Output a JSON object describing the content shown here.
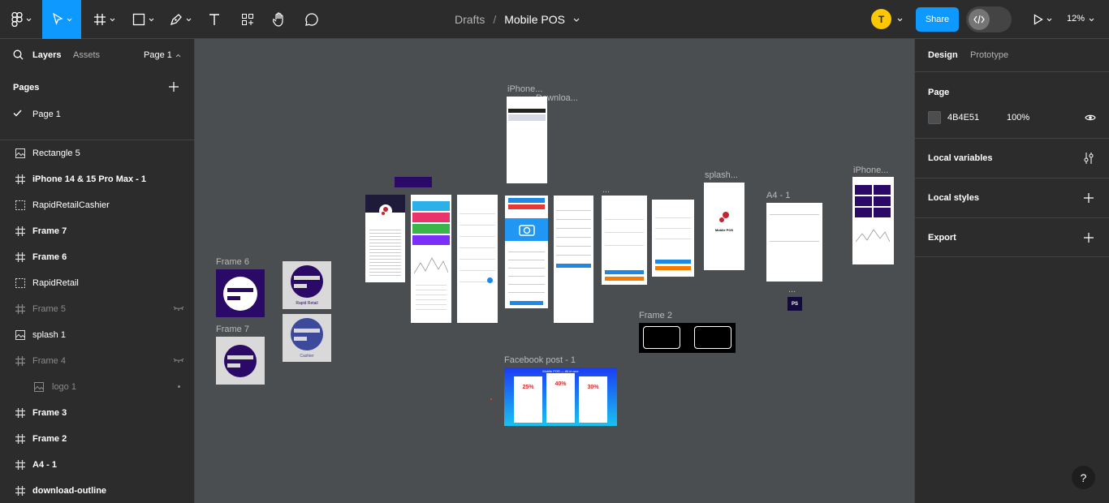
{
  "toolbar": {
    "breadcrumb_root": "Drafts",
    "breadcrumb_sep": "/",
    "file_name": "Mobile POS",
    "avatar_initial": "T",
    "share_label": "Share",
    "zoom": "12%",
    "accent_color": "#0d99ff"
  },
  "left_panel": {
    "tabs": {
      "layers": "Layers",
      "assets": "Assets",
      "page_switch": "Page 1"
    },
    "pages_title": "Pages",
    "current_page": "Page 1",
    "layers": [
      {
        "label": "Rectangle 5",
        "icon": "image-icon"
      },
      {
        "label": "iPhone 14 & 15 Pro Max - 1",
        "icon": "frame-icon"
      },
      {
        "label": "RapidRetailCashier",
        "icon": "section-icon"
      },
      {
        "label": "Frame 7",
        "icon": "frame-icon"
      },
      {
        "label": "Frame 6",
        "icon": "frame-icon"
      },
      {
        "label": "RapidRetail",
        "icon": "section-icon"
      },
      {
        "label": "Frame 5",
        "icon": "frame-icon"
      },
      {
        "label": "splash 1",
        "icon": "image-icon"
      },
      {
        "label": "Frame 4",
        "icon": "frame-icon"
      },
      {
        "label": "logo 1",
        "icon": "image-icon"
      },
      {
        "label": "Frame 3",
        "icon": "frame-icon"
      },
      {
        "label": "Frame 2",
        "icon": "frame-icon"
      },
      {
        "label": "A4 - 1",
        "icon": "frame-icon"
      },
      {
        "label": "download-outline",
        "icon": "frame-icon"
      }
    ]
  },
  "canvas": {
    "background": "#4b4e51",
    "labels": {
      "frame6": "Frame 6",
      "frame7": "Frame 7",
      "iphone_top": "iPhone...",
      "download": "Downloa...",
      "splash": "splash...",
      "a4": "A4 - 1",
      "iphone_right": "iPhone...",
      "frame2": "Frame 2",
      "facebook": "Facebook post - 1",
      "logo_rapid": "Rapid Retail",
      "logo_cashier": "Cashier",
      "splash_app": "Mobile POS",
      "ellipsis": "...",
      "fb_header": "Mobile POS — All-in-one",
      "fb_offer1": "25%",
      "fb_offer2": "40%",
      "fb_offer3": "30%",
      "ps_badge": "PS"
    }
  },
  "right_panel": {
    "tabs": {
      "design": "Design",
      "prototype": "Prototype"
    },
    "page_section": "Page",
    "page_color": "4B4E51",
    "page_opacity": "100%",
    "local_variables": "Local variables",
    "local_styles": "Local styles",
    "export": "Export"
  },
  "help": "?"
}
